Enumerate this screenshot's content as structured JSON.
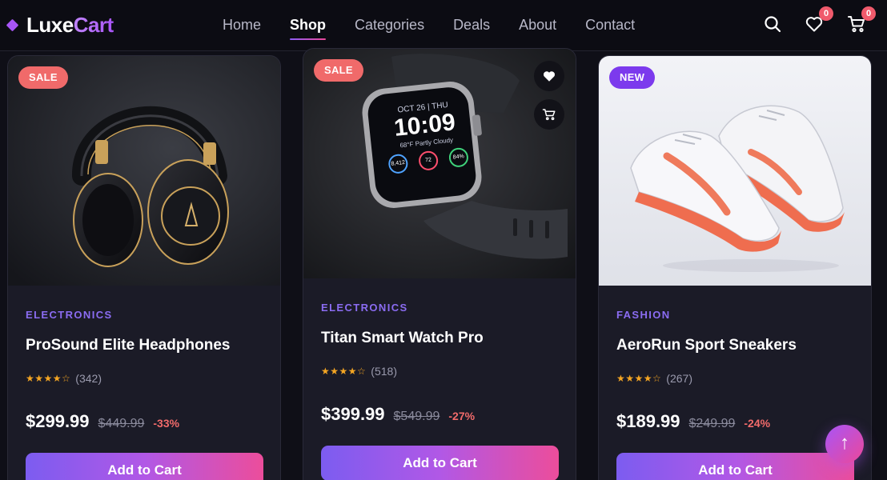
{
  "brand": {
    "name_a": "Luxe",
    "name_b": "Cart"
  },
  "nav": {
    "links": [
      {
        "label": "Home"
      },
      {
        "label": "Shop",
        "active": true
      },
      {
        "label": "Categories"
      },
      {
        "label": "Deals"
      },
      {
        "label": "About"
      },
      {
        "label": "Contact"
      }
    ],
    "icons": {
      "search": "search-icon",
      "wishlist": "heart-icon",
      "cart": "cart-icon"
    },
    "wishlist_count": "0",
    "cart_count": "0"
  },
  "products": [
    {
      "tag": "SALE",
      "category": "ELECTRONICS",
      "title": "ProSound Elite Headphones",
      "stars": "★★★★☆",
      "rating": 4.5,
      "reviews": "(342)",
      "price": "$299.99",
      "old_price": "$449.99",
      "discount": "-33%",
      "button": "Add to Cart"
    },
    {
      "tag": "SALE",
      "category": "ELECTRONICS",
      "title": "Titan Smart Watch Pro",
      "stars": "★★★★☆",
      "rating": 4.5,
      "reviews": "(518)",
      "price": "$399.99",
      "old_price": "$549.99",
      "discount": "-27%",
      "button": "Add to Cart",
      "watch": {
        "date": "OCT 26 | THU",
        "time": "10:09",
        "weather": "68°F Partly Cloudy",
        "c1": "8,412",
        "c2": "72",
        "c3": "84%"
      }
    },
    {
      "tag": "NEW",
      "category": "FASHION",
      "title": "AeroRun Sport Sneakers",
      "stars": "★★★★☆",
      "rating": 4.5,
      "reviews": "(267)",
      "price": "$189.99",
      "old_price": "$249.99",
      "discount": "-24%",
      "button": "Add to Cart"
    }
  ],
  "scroll_top": "↑",
  "colors": {
    "accent": "#8b5cf6",
    "pink": "#ec4899",
    "sale": "#f06a6a",
    "new": "#7c3aed",
    "star": "#f5a623"
  }
}
